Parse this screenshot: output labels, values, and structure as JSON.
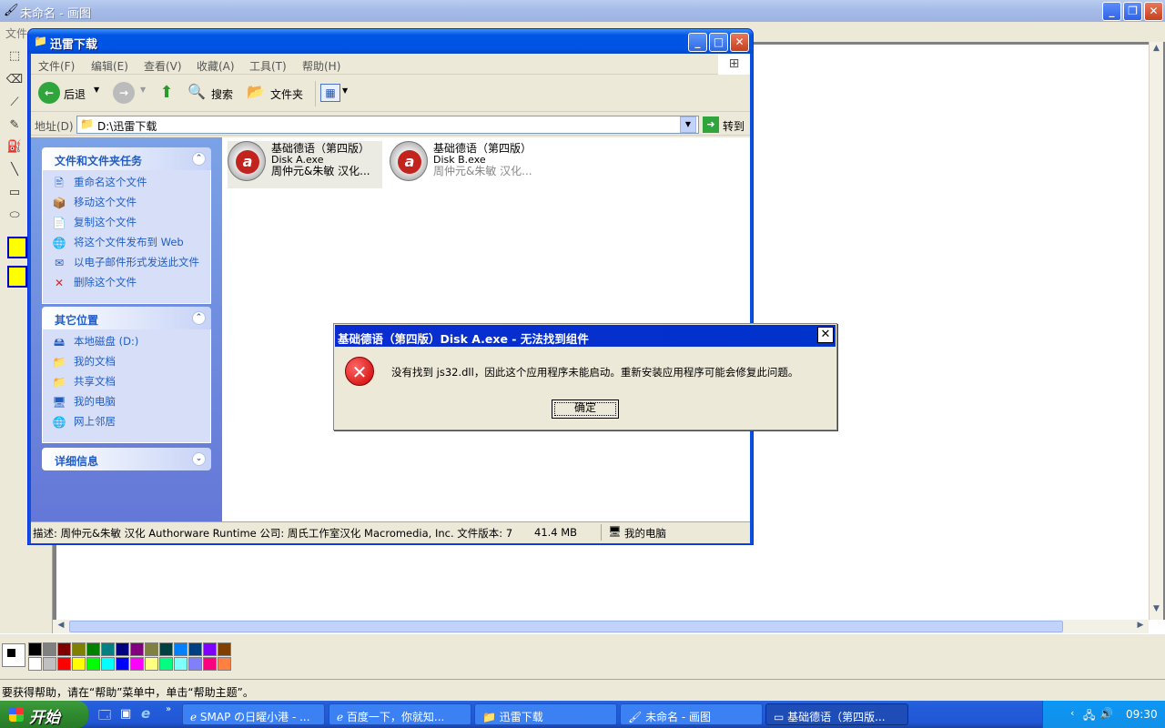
{
  "paint": {
    "title": "未命名 - 画图",
    "menu_first": "文件",
    "status": "要获得帮助，请在“帮助”菜单中，单击“帮助主题”。",
    "palette_colors": [
      "#000000",
      "#808080",
      "#800000",
      "#808000",
      "#008000",
      "#008080",
      "#000080",
      "#800080",
      "#808040",
      "#004040",
      "#0080ff",
      "#004080",
      "#8000ff",
      "#804000",
      "#ffffff",
      "#c0c0c0",
      "#ff0000",
      "#ffff00",
      "#00ff00",
      "#00ffff",
      "#0000ff",
      "#ff00ff",
      "#ffff80",
      "#00ff80",
      "#80ffff",
      "#8080ff",
      "#ff0080",
      "#ff8040"
    ]
  },
  "explorer": {
    "title": "迅雷下载",
    "menu": [
      "文件(F)",
      "编辑(E)",
      "查看(V)",
      "收藏(A)",
      "工具(T)",
      "帮助(H)"
    ],
    "toolbar": {
      "back": "后退",
      "search": "搜索",
      "folders": "文件夹"
    },
    "address_label": "地址(D)",
    "address_value": "D:\\迅雷下载",
    "go_label": "转到",
    "tasks": {
      "header": "文件和文件夹任务",
      "items": [
        "重命名这个文件",
        "移动这个文件",
        "复制这个文件",
        "将这个文件发布到 Web",
        "以电子邮件形式发送此文件",
        "删除这个文件"
      ]
    },
    "places": {
      "header": "其它位置",
      "items": [
        "本地磁盘 (D:)",
        "我的文档",
        "共享文档",
        "我的电脑",
        "网上邻居"
      ]
    },
    "details": {
      "header": "详细信息"
    },
    "files": [
      {
        "name": "基础德语（第四版）",
        "exe": "Disk A.exe",
        "desc": "周仲元&朱敏 汉化..."
      },
      {
        "name": "基础德语（第四版）",
        "exe": "Disk B.exe",
        "desc": "周仲元&朱敏 汉化..."
      }
    ],
    "status_desc": "描述: 周仲元&朱敏 汉化 Authorware Runtime 公司: 周氏工作室汉化  Macromedia, Inc. 文件版本: 7",
    "status_size": "41.4 MB",
    "status_location": "我的电脑"
  },
  "dialog": {
    "title": "基础德语（第四版）Disk A.exe - 无法找到组件",
    "message": "没有找到 js32.dll，因此这个应用程序未能启动。重新安装应用程序可能会修复此问题。",
    "ok_label": "确定"
  },
  "taskbar": {
    "start_label": "开始",
    "buttons": [
      "SMAP の日曜小港 - ...",
      "百度一下，你就知...",
      "迅雷下载",
      "未命名 - 画图",
      "基础德语（第四版..."
    ],
    "clock": "09:30"
  }
}
